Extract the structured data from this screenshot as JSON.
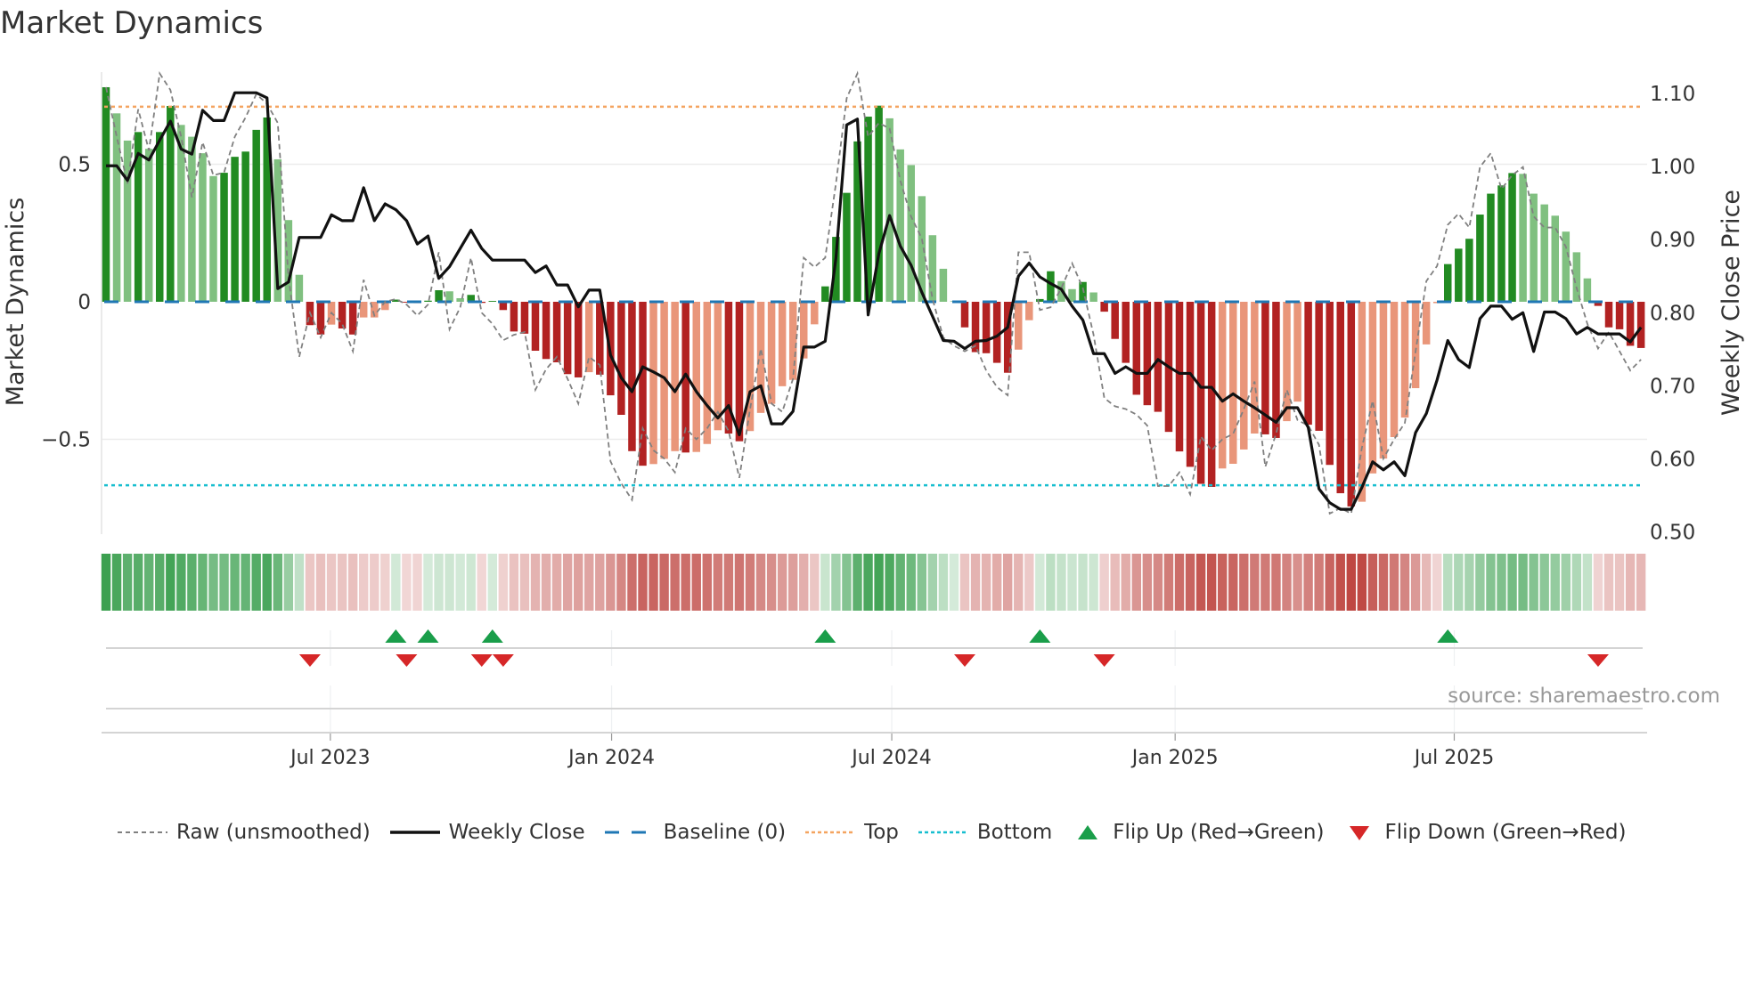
{
  "title": "Market Dynamics",
  "source": "source: sharemaestro.com",
  "chart_data": {
    "type": "bar",
    "title": "Market Dynamics",
    "ylabel": "Market Dynamics",
    "y2label": "Weekly Close Price",
    "xlabel": "",
    "ylim": [
      -0.84,
      0.86
    ],
    "y2lim": [
      0.5,
      1.1
    ],
    "yticks": [
      {
        "v": 0.5,
        "label": "0.5"
      },
      {
        "v": 0,
        "label": "0"
      },
      {
        "v": -0.5,
        "label": "−0.5"
      }
    ],
    "y2ticks": [
      {
        "v": 1.1,
        "label": "1.10"
      },
      {
        "v": 1.0,
        "label": "1.00"
      },
      {
        "v": 0.9,
        "label": "0.90"
      },
      {
        "v": 0.8,
        "label": "0.80"
      },
      {
        "v": 0.7,
        "label": "0.70"
      },
      {
        "v": 0.6,
        "label": "0.60"
      },
      {
        "v": 0.5,
        "label": "0.50"
      }
    ],
    "xticks": [
      {
        "week": 20.9,
        "label": "Jul 2023"
      },
      {
        "week": 47.1,
        "label": "Jan 2024"
      },
      {
        "week": 73.2,
        "label": "Jul 2024"
      },
      {
        "week": 99.6,
        "label": "Jan 2025"
      },
      {
        "week": 125.6,
        "label": "Jul 2025"
      }
    ],
    "top_level": 0.709,
    "bottom_level": -0.667,
    "baseline": 0,
    "dynamics": [
      0.78,
      0.685,
      0.586,
      0.617,
      0.556,
      0.617,
      0.712,
      0.643,
      0.6,
      0.54,
      0.457,
      0.469,
      0.527,
      0.546,
      0.625,
      0.67,
      0.518,
      0.297,
      0.098,
      -0.085,
      -0.119,
      -0.083,
      -0.097,
      -0.119,
      -0.057,
      -0.057,
      -0.03,
      0.008,
      -0.003,
      -0.005,
      0.004,
      0.042,
      0.038,
      0.013,
      0.025,
      -0.004,
      0.003,
      -0.03,
      -0.108,
      -0.116,
      -0.178,
      -0.208,
      -0.22,
      -0.263,
      -0.275,
      -0.256,
      -0.265,
      -0.34,
      -0.411,
      -0.543,
      -0.596,
      -0.59,
      -0.571,
      -0.543,
      -0.548,
      -0.546,
      -0.517,
      -0.467,
      -0.479,
      -0.507,
      -0.47,
      -0.404,
      -0.371,
      -0.307,
      -0.284,
      -0.206,
      -0.082,
      0.056,
      0.236,
      0.396,
      0.583,
      0.673,
      0.713,
      0.667,
      0.554,
      0.497,
      0.384,
      0.242,
      0.12,
      0.002,
      -0.093,
      -0.183,
      -0.187,
      -0.222,
      -0.258,
      -0.174,
      -0.067,
      0.01,
      0.111,
      0.075,
      0.046,
      0.072,
      0.034,
      -0.036,
      -0.135,
      -0.222,
      -0.338,
      -0.376,
      -0.4,
      -0.473,
      -0.544,
      -0.6,
      -0.662,
      -0.673,
      -0.606,
      -0.589,
      -0.537,
      -0.479,
      -0.482,
      -0.495,
      -0.434,
      -0.363,
      -0.447,
      -0.469,
      -0.593,
      -0.696,
      -0.744,
      -0.727,
      -0.624,
      -0.57,
      -0.492,
      -0.421,
      -0.314,
      -0.155,
      -0.005,
      0.137,
      0.193,
      0.229,
      0.317,
      0.393,
      0.423,
      0.468,
      0.465,
      0.393,
      0.354,
      0.313,
      0.255,
      0.18,
      0.085,
      -0.015,
      -0.093,
      -0.1,
      -0.16,
      -0.168
    ],
    "raw": [
      0.78,
      0.6,
      0.43,
      0.7,
      0.55,
      0.83,
      0.77,
      0.6,
      0.38,
      0.58,
      0.46,
      0.47,
      0.6,
      0.67,
      0.755,
      0.72,
      0.65,
      0.09,
      -0.2,
      -0.04,
      -0.13,
      -0.04,
      -0.08,
      -0.18,
      0.08,
      -0.05,
      0.0,
      0.01,
      -0.01,
      -0.05,
      -0.01,
      0.18,
      -0.1,
      -0.02,
      0.16,
      -0.04,
      -0.08,
      -0.14,
      -0.12,
      -0.11,
      -0.32,
      -0.245,
      -0.2,
      -0.28,
      -0.37,
      -0.2,
      -0.23,
      -0.58,
      -0.66,
      -0.72,
      -0.46,
      -0.54,
      -0.57,
      -0.62,
      -0.46,
      -0.5,
      -0.46,
      -0.4,
      -0.47,
      -0.64,
      -0.39,
      -0.17,
      -0.37,
      -0.4,
      -0.28,
      0.16,
      0.126,
      0.16,
      0.43,
      0.74,
      0.83,
      0.6,
      0.65,
      0.63,
      0.44,
      0.31,
      0.23,
      0.01,
      -0.13,
      -0.16,
      -0.18,
      -0.16,
      -0.25,
      -0.31,
      -0.34,
      0.18,
      0.18,
      -0.03,
      -0.02,
      0.05,
      0.14,
      0.05,
      -0.12,
      -0.35,
      -0.38,
      -0.39,
      -0.41,
      -0.45,
      -0.67,
      -0.67,
      -0.62,
      -0.7,
      -0.49,
      -0.54,
      -0.5,
      -0.48,
      -0.39,
      -0.29,
      -0.6,
      -0.48,
      -0.32,
      -0.43,
      -0.45,
      -0.52,
      -0.77,
      -0.75,
      -0.77,
      -0.53,
      -0.36,
      -0.57,
      -0.5,
      -0.44,
      -0.18,
      0.075,
      0.13,
      0.28,
      0.32,
      0.27,
      0.49,
      0.54,
      0.41,
      0.46,
      0.49,
      0.31,
      0.27,
      0.27,
      0.2,
      0.05,
      -0.08,
      -0.17,
      -0.11,
      -0.18,
      -0.25,
      -0.21
    ],
    "weekly_close": [
      1.001,
      1.001,
      0.981,
      1.018,
      1.009,
      1.036,
      1.062,
      1.024,
      1.017,
      1.077,
      1.063,
      1.063,
      1.101,
      1.101,
      1.101,
      1.094,
      0.833,
      0.842,
      0.903,
      0.903,
      0.903,
      0.934,
      0.926,
      0.926,
      0.971,
      0.926,
      0.949,
      0.941,
      0.926,
      0.894,
      0.905,
      0.847,
      0.863,
      0.888,
      0.913,
      0.888,
      0.872,
      0.872,
      0.872,
      0.872,
      0.855,
      0.864,
      0.838,
      0.838,
      0.808,
      0.831,
      0.831,
      0.742,
      0.711,
      0.692,
      0.726,
      0.719,
      0.711,
      0.692,
      0.716,
      0.692,
      0.673,
      0.656,
      0.673,
      0.633,
      0.692,
      0.7,
      0.648,
      0.648,
      0.665,
      0.753,
      0.753,
      0.761,
      0.875,
      1.057,
      1.065,
      0.797,
      0.881,
      0.933,
      0.891,
      0.865,
      0.828,
      0.795,
      0.762,
      0.761,
      0.751,
      0.761,
      0.762,
      0.768,
      0.78,
      0.85,
      0.868,
      0.849,
      0.84,
      0.832,
      0.809,
      0.79,
      0.744,
      0.744,
      0.717,
      0.726,
      0.717,
      0.717,
      0.736,
      0.726,
      0.717,
      0.717,
      0.698,
      0.698,
      0.679,
      0.689,
      0.679,
      0.67,
      0.66,
      0.65,
      0.67,
      0.67,
      0.643,
      0.559,
      0.54,
      0.531,
      0.531,
      0.561,
      0.596,
      0.585,
      0.596,
      0.577,
      0.636,
      0.662,
      0.708,
      0.762,
      0.736,
      0.725,
      0.792,
      0.809,
      0.809,
      0.791,
      0.8,
      0.747,
      0.801,
      0.801,
      0.792,
      0.771,
      0.78,
      0.771,
      0.771,
      0.771,
      0.76,
      0.78
    ],
    "flip_up_weeks": [
      27,
      30,
      36,
      67,
      87,
      125
    ],
    "flip_down_weeks": [
      19,
      28,
      35,
      37,
      80,
      93,
      139
    ],
    "legend_position": "bottom"
  },
  "colors": {
    "pos_strong": "#228b22",
    "pos_weak": "#80c080",
    "neg_strong": "#b22222",
    "neg_weak": "#e9967a",
    "baseline": "#1f77b4",
    "top": "#f4a460",
    "bottom": "#17becf",
    "flip_up": "#1a9e4a",
    "flip_down": "#d62728",
    "raw": "#808080",
    "close": "#111111"
  },
  "legend": [
    {
      "key": "raw",
      "label": "Raw (unsmoothed)"
    },
    {
      "key": "close",
      "label": "Weekly Close"
    },
    {
      "key": "baseline",
      "label": "Baseline (0)"
    },
    {
      "key": "top",
      "label": "Top"
    },
    {
      "key": "bottom",
      "label": "Bottom"
    },
    {
      "key": "flip_up",
      "label": "Flip Up (Red→Green)"
    },
    {
      "key": "flip_down",
      "label": "Flip Down (Green→Red)"
    }
  ]
}
